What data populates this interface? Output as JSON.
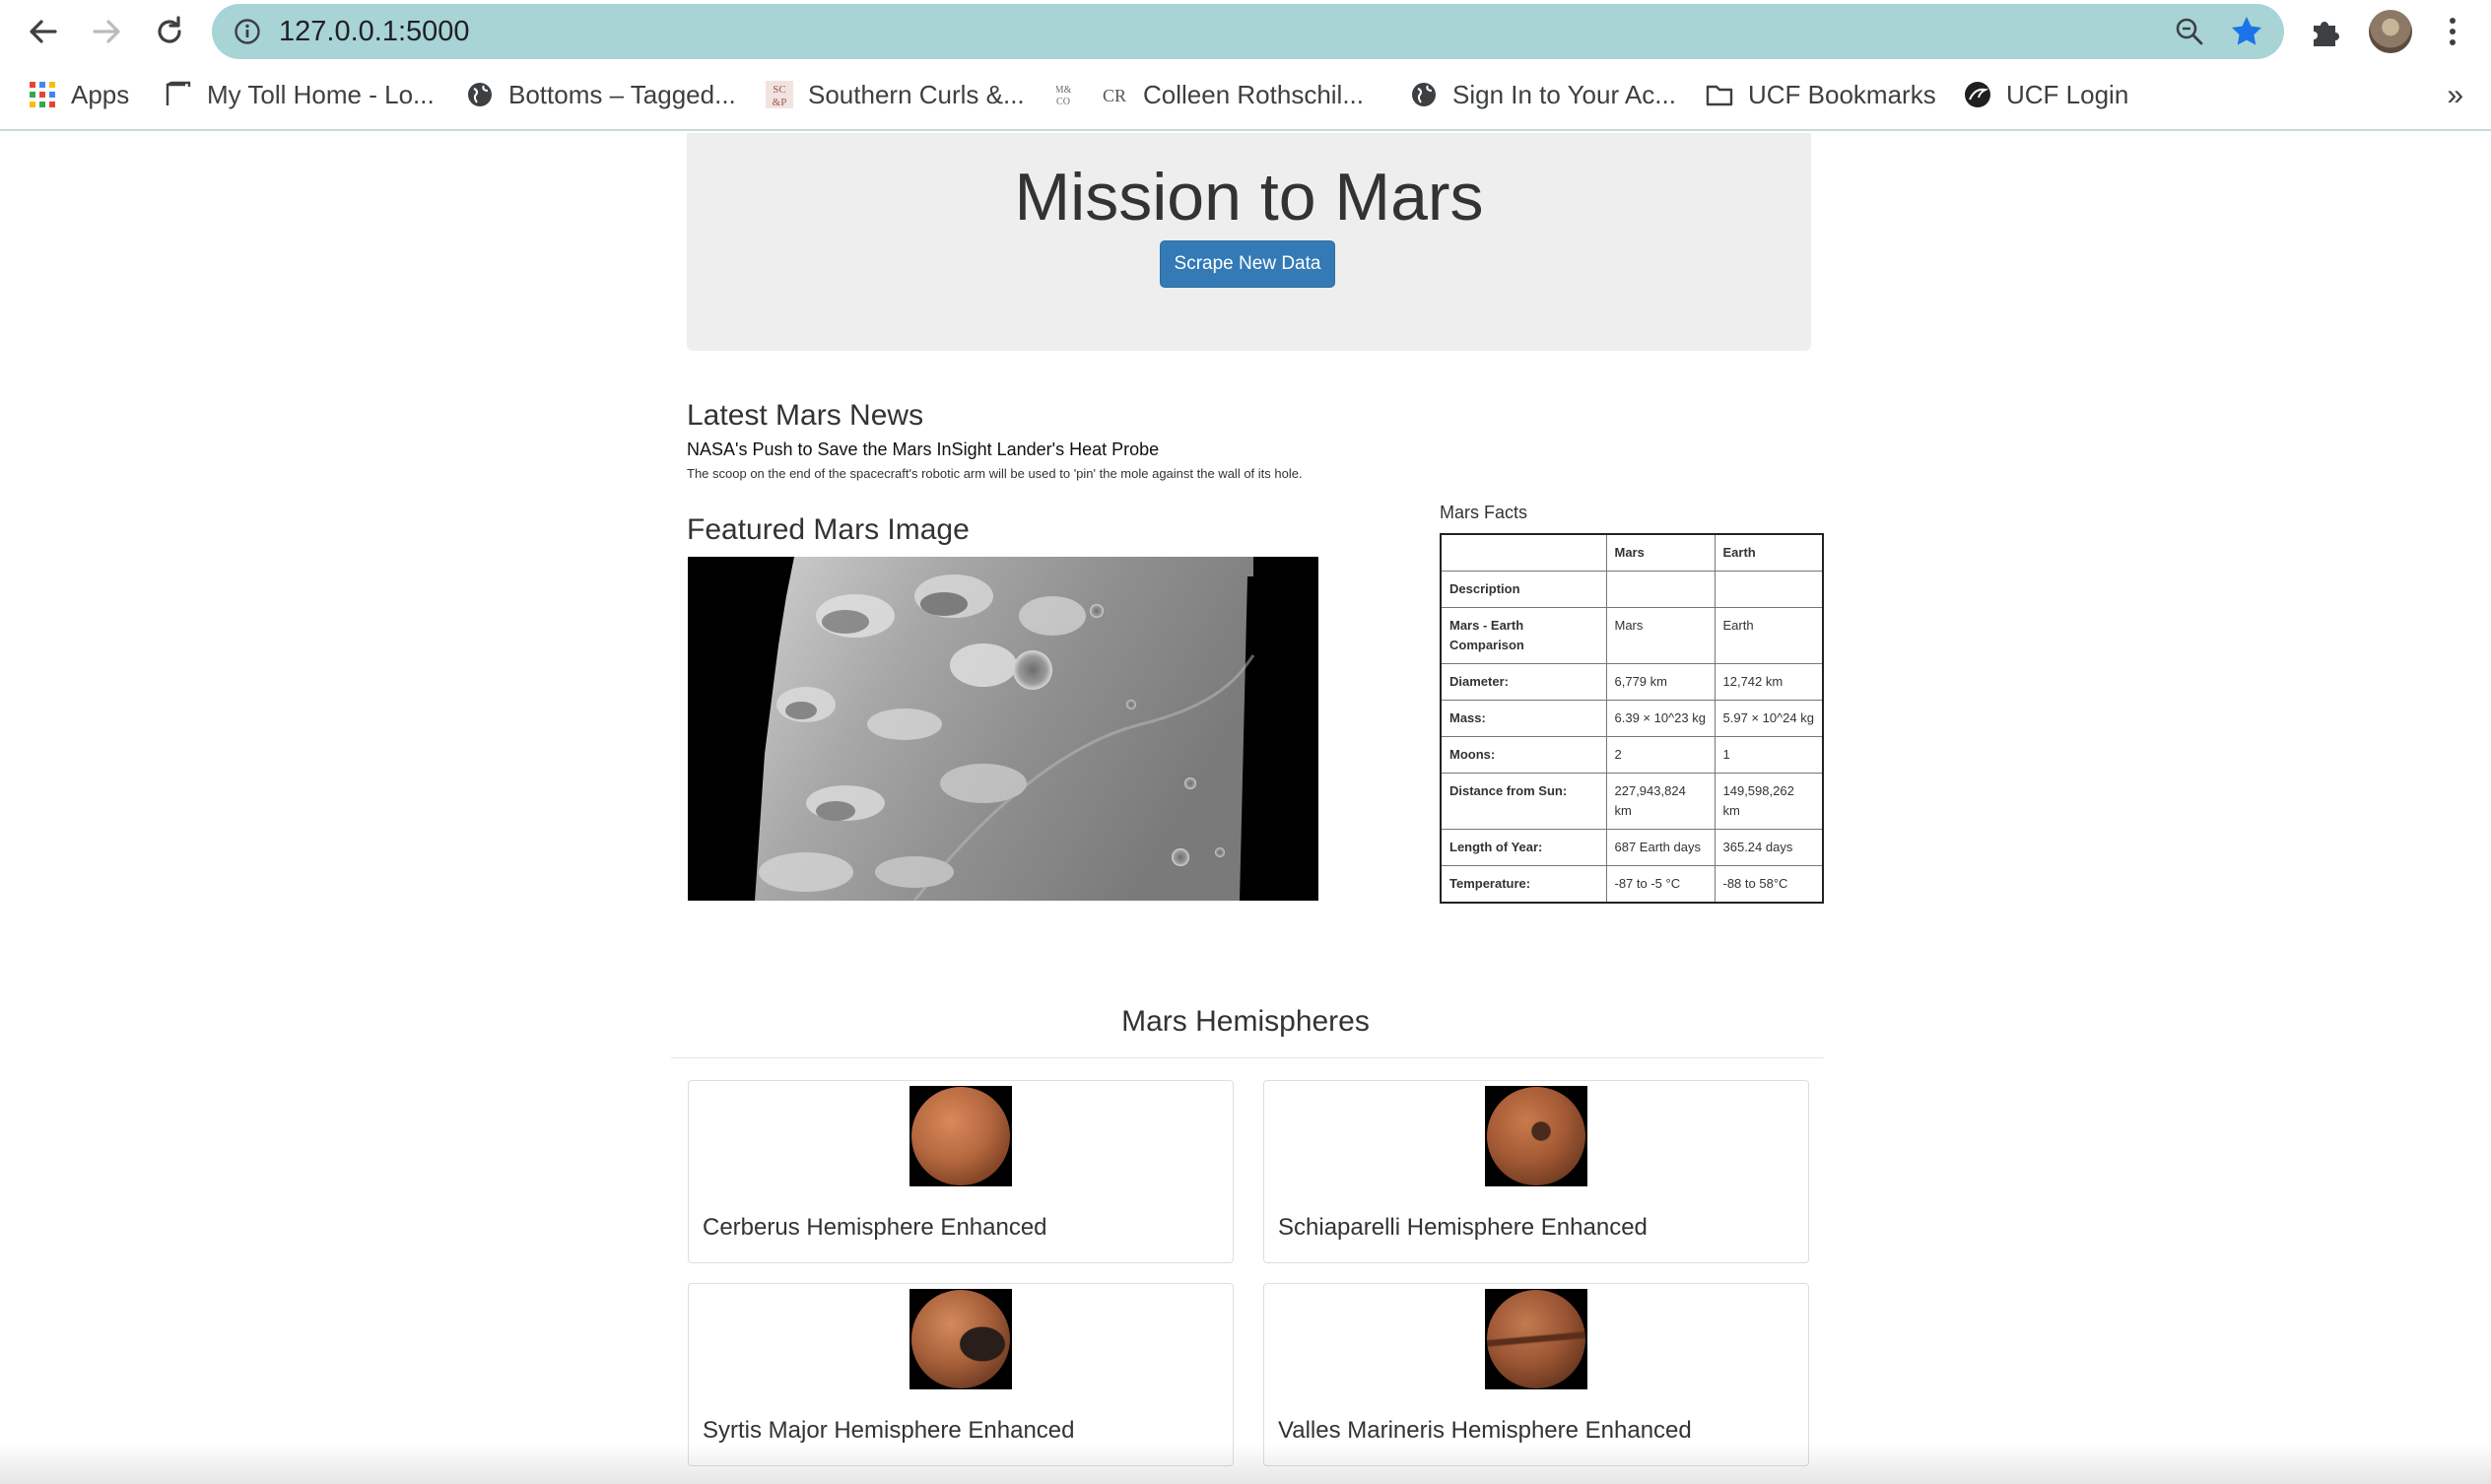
{
  "browser": {
    "url": "127.0.0.1:5000",
    "bookmarks": [
      {
        "label": "Apps",
        "icon": "apps-grid-icon"
      },
      {
        "label": "My Toll Home - Lo...",
        "icon": "home-page-icon"
      },
      {
        "label": "Bottoms – Tagged...",
        "icon": "globe-icon"
      },
      {
        "label": "Southern Curls &...",
        "icon": "southern-curls-logo-icon"
      },
      {
        "label": "Colleen Rothschil...",
        "icon": "colleen-rothschild-logo-icon"
      },
      {
        "label": "Sign In to Your Ac...",
        "icon": "globe-icon"
      },
      {
        "label": "UCF Bookmarks",
        "icon": "folder-icon"
      },
      {
        "label": "UCF Login",
        "icon": "ucf-logo-icon"
      }
    ],
    "more_bookmarks": "»"
  },
  "page": {
    "title": "Mission to Mars",
    "scrape_button": "Scrape New Data",
    "news": {
      "heading": "Latest Mars News",
      "title": "NASA's Push to Save the Mars InSight Lander's Heat Probe",
      "paragraph": "The scoop on the end of the spacecraft's robotic arm will be used to 'pin' the mole against the wall of its hole."
    },
    "featured_image": {
      "heading": "Featured Mars Image"
    },
    "facts": {
      "heading": "Mars Facts",
      "columns": [
        "",
        "Mars",
        "Earth"
      ],
      "rows": [
        {
          "label": "Description",
          "mars": "",
          "earth": ""
        },
        {
          "label": "Mars - Earth Comparison",
          "mars": "Mars",
          "earth": "Earth"
        },
        {
          "label": "Diameter:",
          "mars": "6,779 km",
          "earth": "12,742 km"
        },
        {
          "label": "Mass:",
          "mars": "6.39 × 10^23 kg",
          "earth": "5.97 × 10^24 kg"
        },
        {
          "label": "Moons:",
          "mars": "2",
          "earth": "1"
        },
        {
          "label": "Distance from Sun:",
          "mars": "227,943,824 km",
          "earth": "149,598,262 km"
        },
        {
          "label": "Length of Year:",
          "mars": "687 Earth days",
          "earth": "365.24 days"
        },
        {
          "label": "Temperature:",
          "mars": "-87 to -5 °C",
          "earth": "-88 to 58°C"
        }
      ]
    },
    "hemispheres": {
      "heading": "Mars Hemispheres",
      "items": [
        {
          "title": "Cerberus Hemisphere Enhanced",
          "color": "#b5683f"
        },
        {
          "title": "Schiaparelli Hemisphere Enhanced",
          "color": "#a45a35"
        },
        {
          "title": "Syrtis Major Hemisphere Enhanced",
          "color": "#a8603a"
        },
        {
          "title": "Valles Marineris Hemisphere Enhanced",
          "color": "#9c5634"
        }
      ]
    }
  },
  "colors": {
    "omnibox": "#a8d4d6",
    "accent_button": "#337ab7",
    "jumbotron": "#eeeeee",
    "bookmark_star": "#1a73e8"
  }
}
